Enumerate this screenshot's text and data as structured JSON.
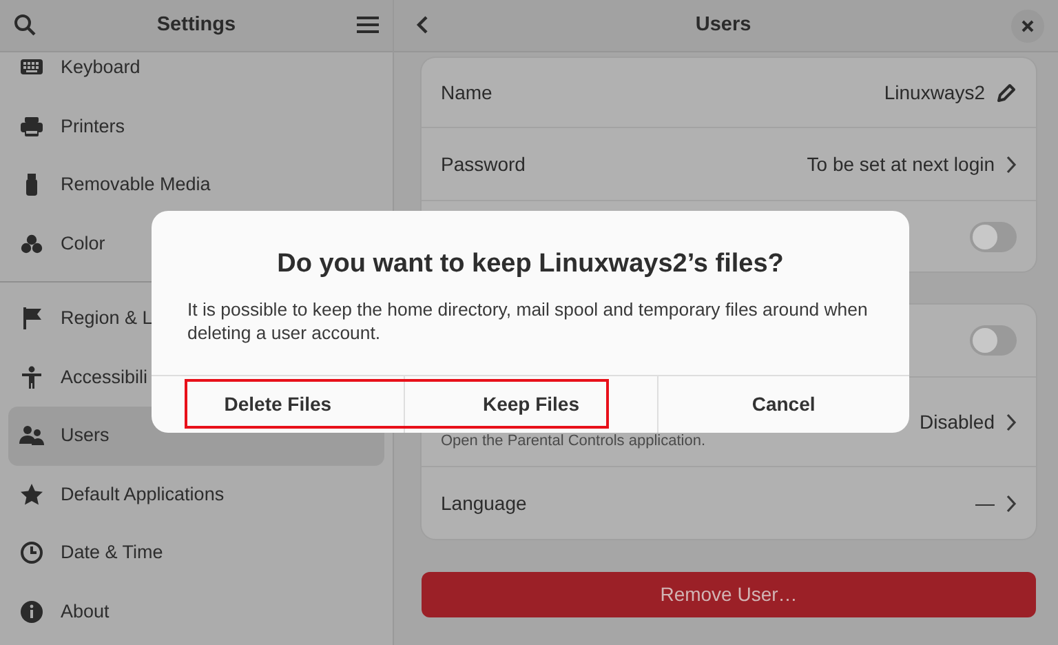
{
  "sidebar": {
    "title": "Settings",
    "groups": [
      {
        "items": [
          {
            "label": "Keyboard",
            "selected": false
          },
          {
            "label": "Printers",
            "selected": false
          },
          {
            "label": "Removable Media",
            "selected": false
          },
          {
            "label": "Color",
            "selected": false
          }
        ]
      },
      {
        "items": [
          {
            "label": "Region & L",
            "selected": false
          },
          {
            "label": "Accessibili",
            "selected": false
          },
          {
            "label": "Users",
            "selected": true
          },
          {
            "label": "Default Applications",
            "selected": false
          },
          {
            "label": "Date & Time",
            "selected": false
          },
          {
            "label": "About",
            "selected": false
          }
        ]
      }
    ]
  },
  "page": {
    "title": "Users",
    "cards": [
      {
        "rows": [
          {
            "kind": "edit",
            "label": "Name",
            "value": "Linuxways2"
          },
          {
            "kind": "link",
            "label": "Password",
            "value": "To be set at next login"
          },
          {
            "kind": "toggle",
            "on": false
          }
        ]
      },
      {
        "rows": [
          {
            "kind": "toggle",
            "on": false
          },
          {
            "kind": "link",
            "subtitle": "Open the Parental Controls application.",
            "value": "Disabled"
          },
          {
            "kind": "link",
            "label": "Language",
            "value": "—"
          }
        ]
      }
    ],
    "remove_button": "Remove User…"
  },
  "dialog": {
    "title": "Do you want to keep Linuxways2’s files?",
    "body": "It is possible to keep the home directory, mail spool and temporary files around when deleting a user account.",
    "buttons": [
      {
        "label": "Delete Files",
        "highlighted": true
      },
      {
        "label": "Keep Files",
        "highlighted": true
      },
      {
        "label": "Cancel",
        "highlighted": false
      }
    ]
  }
}
